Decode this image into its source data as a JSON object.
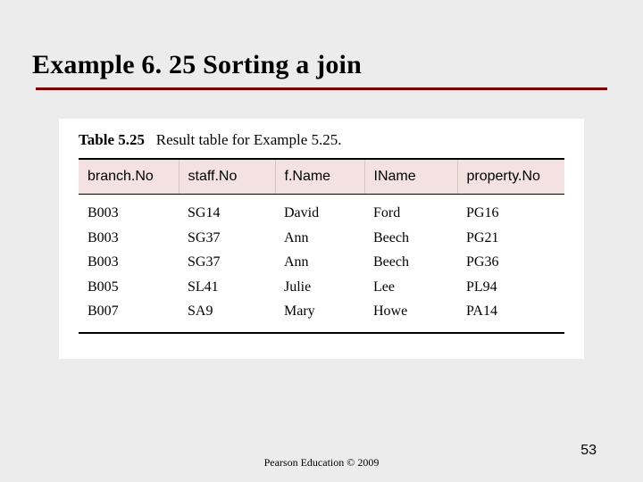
{
  "title": "Example 6. 25  Sorting a join",
  "caption_label": "Table 5.25",
  "caption_text": "Result table for Example 5.25.",
  "columns": [
    "branch.No",
    "staff.No",
    "f.Name",
    "IName",
    "property.No"
  ],
  "rows": [
    [
      "B003",
      "SG14",
      "David",
      "Ford",
      "PG16"
    ],
    [
      "B003",
      "SG37",
      "Ann",
      "Beech",
      "PG21"
    ],
    [
      "B003",
      "SG37",
      "Ann",
      "Beech",
      "PG36"
    ],
    [
      "B005",
      "SL41",
      "Julie",
      "Lee",
      "PL94"
    ],
    [
      "B007",
      "SA9",
      "Mary",
      "Howe",
      "PA14"
    ]
  ],
  "footer": "Pearson Education © 2009",
  "page_number": "53"
}
